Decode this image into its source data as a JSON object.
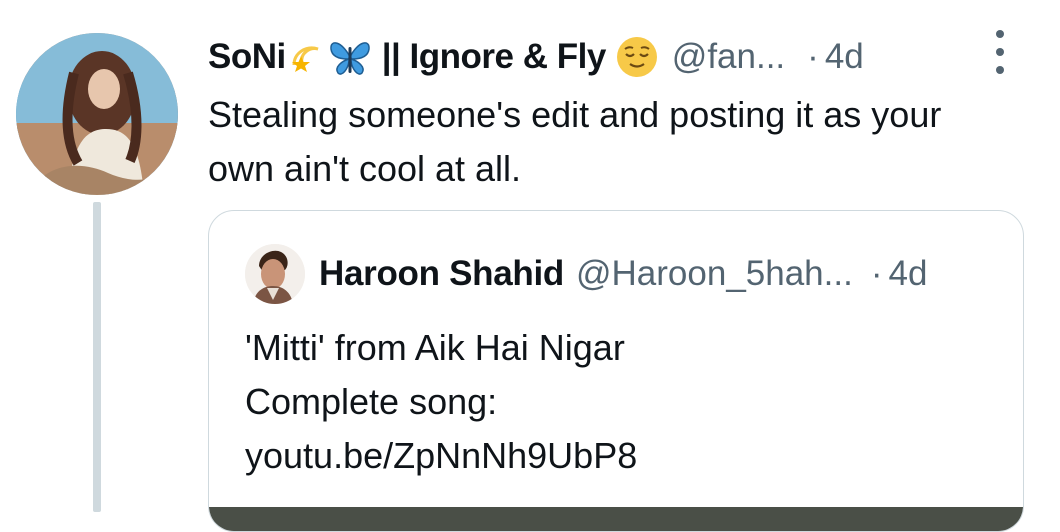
{
  "tweet": {
    "display_name": "SoNi",
    "name_separator": "|| Ignore & Fly",
    "handle": "@fan...",
    "dot": "·",
    "time": "4d",
    "text": "Stealing someone's edit and posting it as your own ain't cool at all."
  },
  "quoted": {
    "display_name": "Haroon Shahid",
    "handle": "@Haroon_5hah...",
    "dot": "·",
    "time": "4d",
    "lines": [
      "'Mitti' from Aik Hai Nigar",
      "Complete song:",
      "youtu.be/ZpNnNh9UbP8"
    ]
  },
  "icons": {
    "name_emojis": [
      "dizzy-star-emoji",
      "butterfly-emoji"
    ],
    "relieved": "relieved-face-emoji",
    "more": "more-vertical-icon"
  },
  "colors": {
    "text": "#0f1419",
    "secondary": "#536471",
    "border": "#cfd9de",
    "butterfly": "#3f9be0",
    "emoji_yellow": "#f7c948"
  }
}
